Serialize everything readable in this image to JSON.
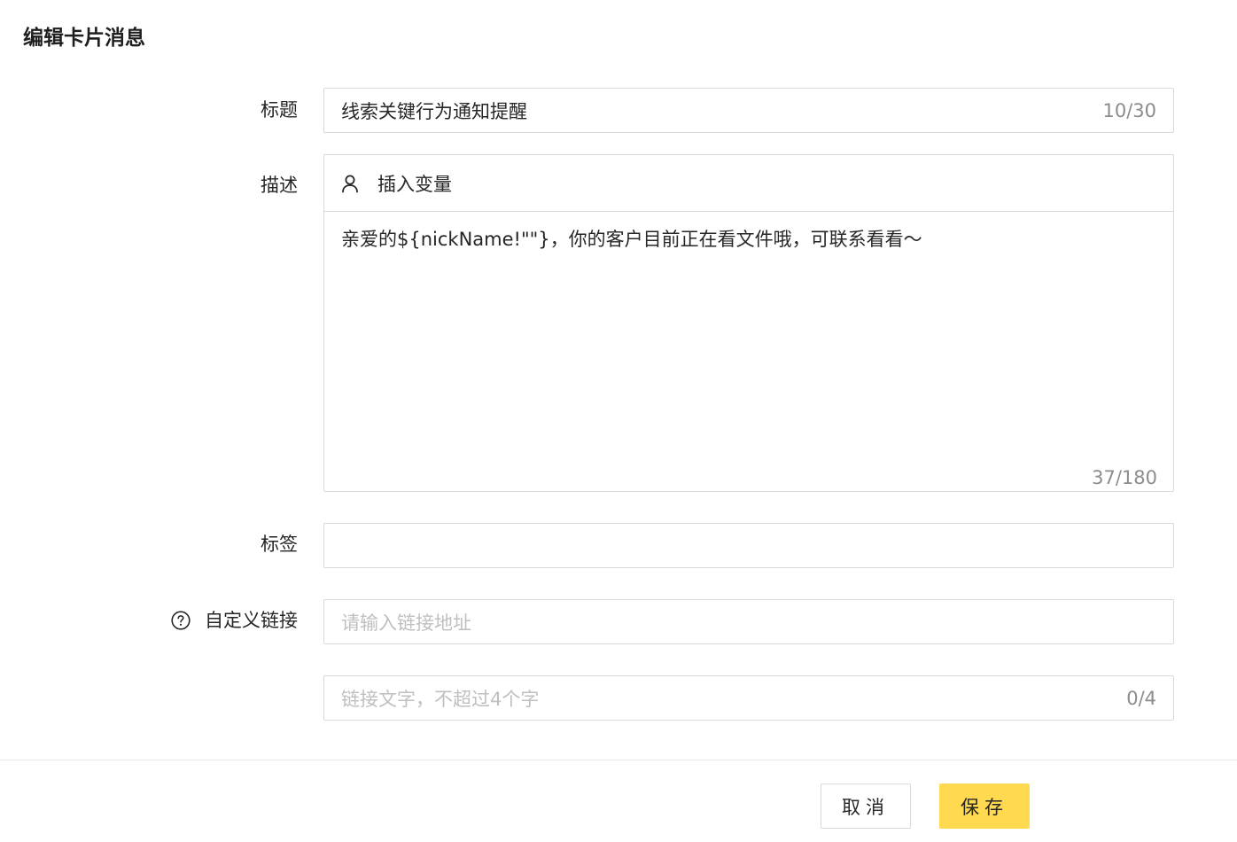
{
  "dialog": {
    "title": "编辑卡片消息"
  },
  "form": {
    "title_field": {
      "label": "标题",
      "value": "线索关键行为通知提醒",
      "count": "10/30"
    },
    "description_field": {
      "label": "描述",
      "insert_variable_label": "插入变量",
      "value": "亲爱的${nickName!\"\"}，你的客户目前正在看文件哦，可联系看看～",
      "count": "37/180"
    },
    "tag_field": {
      "label": "标签",
      "value": ""
    },
    "custom_link_field": {
      "label": "自定义链接",
      "url_placeholder": "请输入链接地址",
      "text_placeholder": "链接文字，不超过4个字",
      "text_count": "0/4"
    }
  },
  "footer": {
    "cancel_label": "取消",
    "save_label": "保存"
  },
  "colors": {
    "primary_button": "#ffd94f",
    "border": "#d9d9d9",
    "placeholder": "#bfbfbf",
    "counter": "#8c8c8c"
  },
  "icons": {
    "help": "question-circle-icon",
    "insert_variable": "user-icon"
  }
}
